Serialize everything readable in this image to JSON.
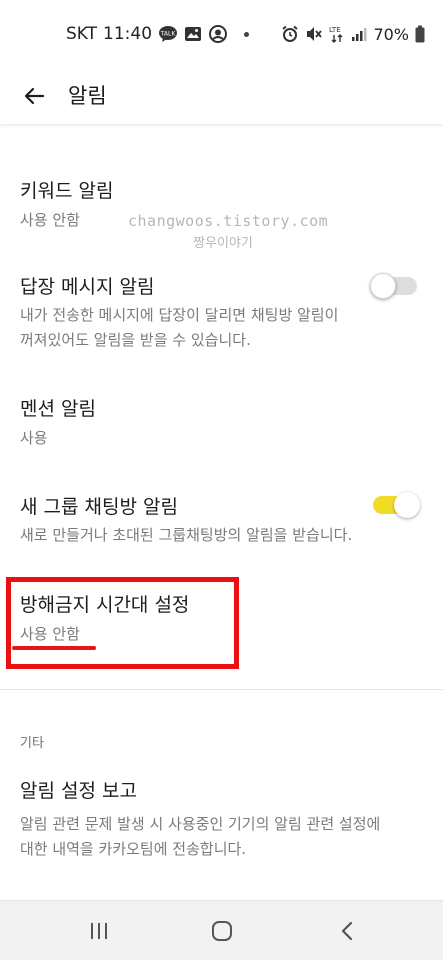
{
  "status_bar": {
    "carrier": "SKT",
    "time": "11:40",
    "battery": "70%",
    "left_icons": [
      "talk-icon",
      "gallery-icon",
      "location-icon",
      "dot"
    ],
    "right_icons": [
      "alarm-icon",
      "mute-icon",
      "lte-icon",
      "signal-icon",
      "battery-icon"
    ]
  },
  "header": {
    "title": "알림"
  },
  "settings": [
    {
      "title": "키워드 알림",
      "subtitle": "사용 안함"
    },
    {
      "title": "답장 메시지 알림",
      "subtitle_lines": [
        "내가 전송한 메시지에 답장이 달리면 채팅방 알림이",
        "꺼져있어도 알림을 받을 수 있습니다."
      ],
      "toggle_on": false
    },
    {
      "title": "멘션 알림",
      "subtitle": "사용"
    },
    {
      "title": "새 그룹 채팅방 알림",
      "subtitle": "새로 만들거나 초대된 그룹채팅방의 알림을 받습니다.",
      "toggle_on": true
    },
    {
      "title": "방해금지 시간대 설정",
      "subtitle": "사용 안함"
    },
    {
      "title": "알림 설정 보고",
      "subtitle_lines": [
        "알림 관련 문제 발생 시 사용중인 기기의 알림 관련 설정에",
        "대한 내역을 카카오팀에 전송합니다."
      ]
    }
  ],
  "section_label": "기타",
  "watermark": {
    "line1": "changwoos.tistory.com",
    "line2": "짱우이야기"
  },
  "colors": {
    "highlight": "#ec0f12",
    "toggle_on": "#f1dc25",
    "toggle_off": "#dedede"
  }
}
